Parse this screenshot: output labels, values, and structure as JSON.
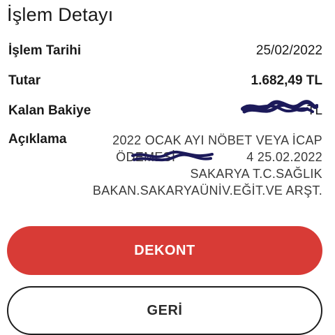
{
  "page": {
    "title": "İşlem Detayı"
  },
  "details": {
    "date_label": "İşlem Tarihi",
    "date_value": "25/02/2022",
    "amount_label": "Tutar",
    "amount_value": "1.682,49 TL",
    "balance_label": "Kalan Bakiye",
    "balance_value_visible": "TL",
    "description_label": "Açıklama",
    "description_lines": [
      "2022 OCAK AYI NÖBET VEYA İCAP",
      "ÖDEMESİ",
      "4 25.02.2022",
      "SAKARYA T.C.SAĞLIK",
      "BAKAN.SAKARYAÜNİV.EĞİT.VE ARŞT."
    ]
  },
  "actions": {
    "receipt_label": "DEKONT",
    "back_label": "GERİ"
  },
  "colors": {
    "primary_button": "#d83b36",
    "redaction_ink": "#1c1a5a"
  }
}
